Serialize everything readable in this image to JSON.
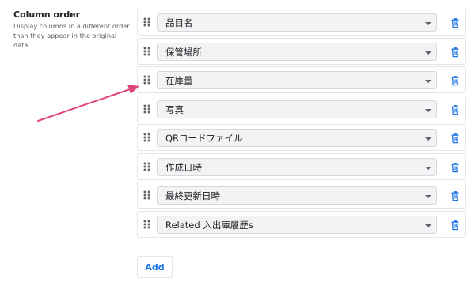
{
  "section": {
    "title": "Column order",
    "description": "Display columns in a different order than they appear in the original data."
  },
  "columns": [
    {
      "label": "品目名"
    },
    {
      "label": "保管場所"
    },
    {
      "label": "在庫量"
    },
    {
      "label": "写真"
    },
    {
      "label": "QRコードファイル"
    },
    {
      "label": "作成日時"
    },
    {
      "label": "最終更新日時"
    },
    {
      "label": "Related 入出庫履歴s"
    }
  ],
  "add_button": {
    "label": "Add"
  },
  "icons": {
    "drag_handle": "drag-handle-icon",
    "dropdown": "chevron-down-icon",
    "delete": "trash-icon",
    "annotation": "arrow-annotation"
  },
  "colors": {
    "accent": "#1a73e8",
    "annotation_arrow": "#e0467c",
    "field_background": "#f1f3f4"
  }
}
